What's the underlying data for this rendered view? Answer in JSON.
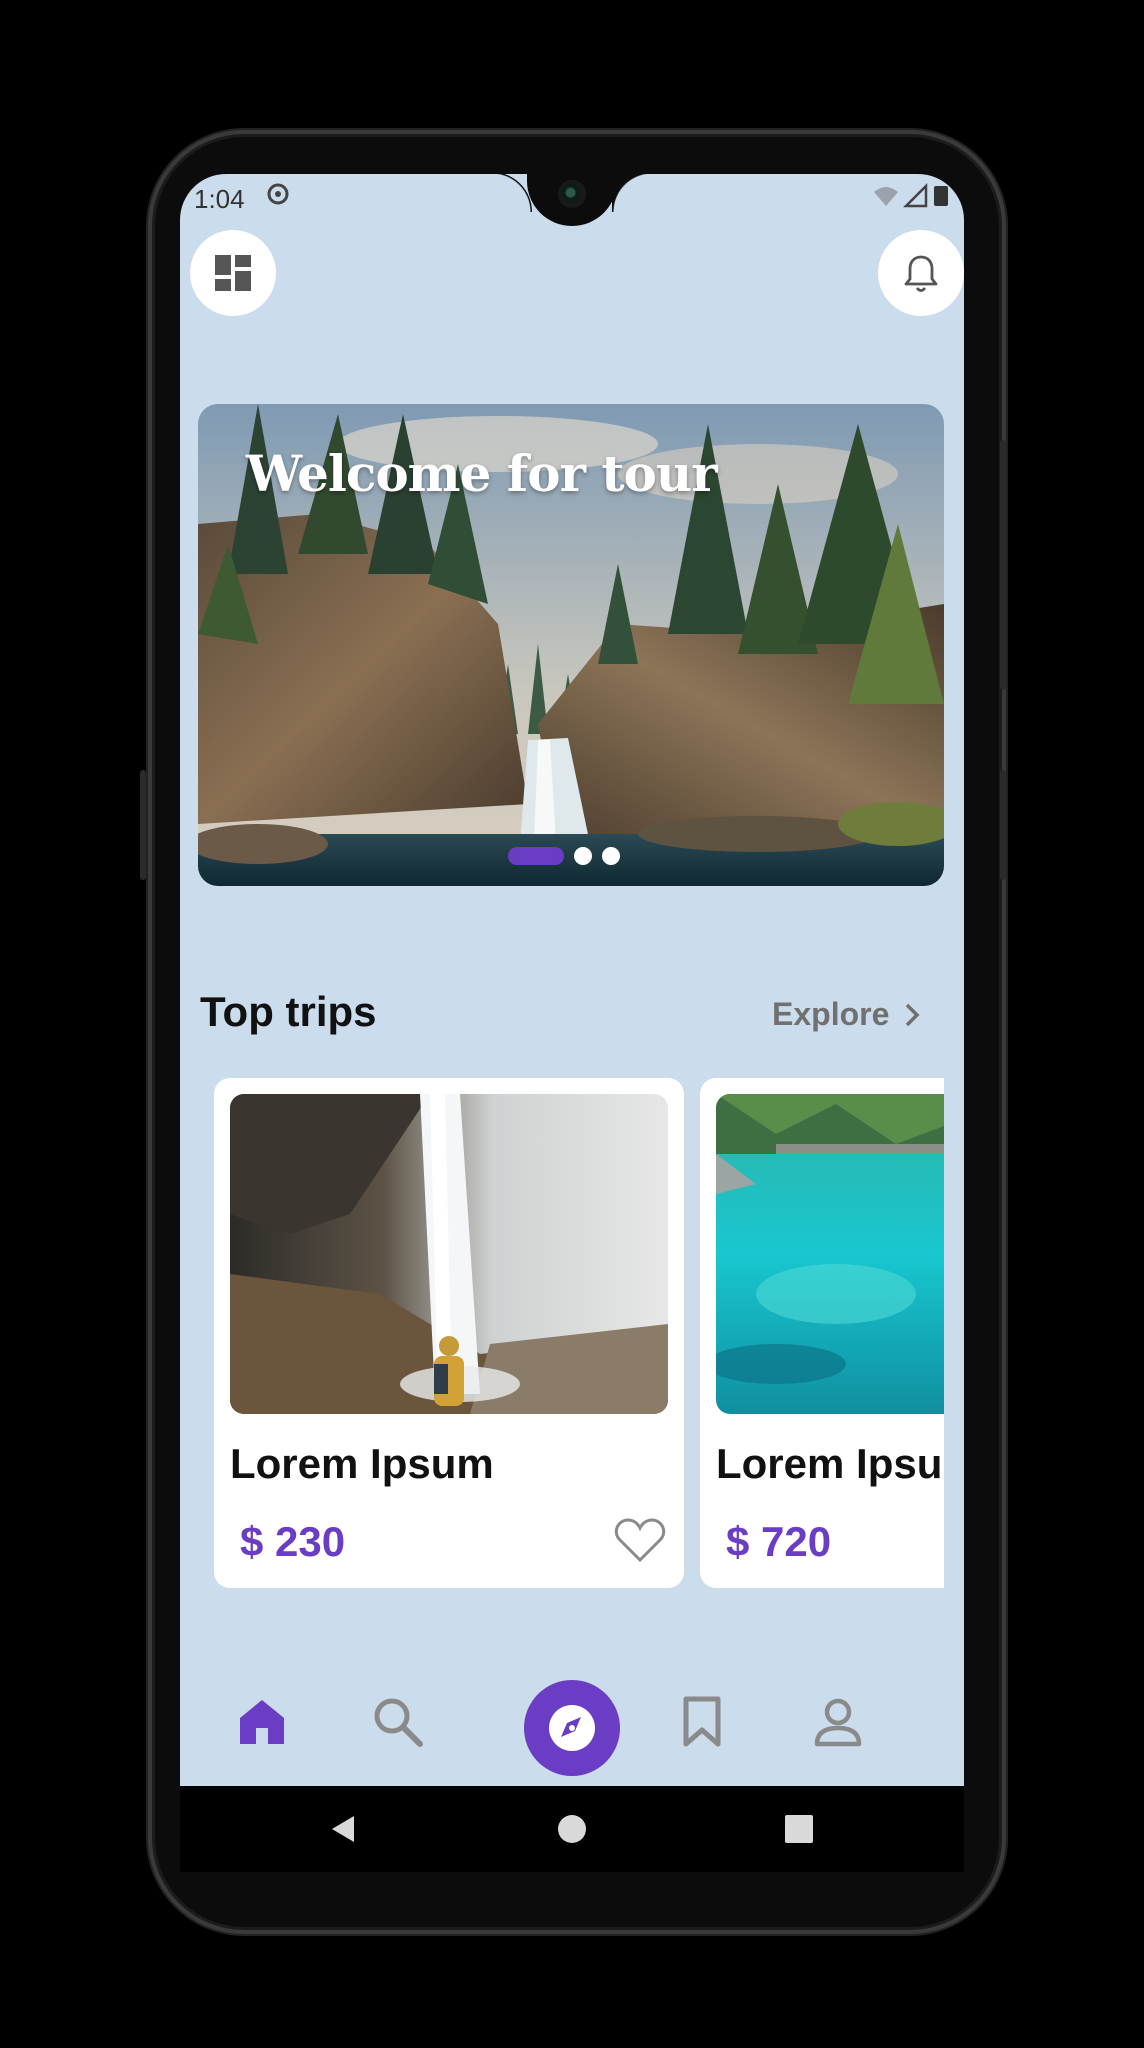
{
  "status_bar": {
    "time": "1:04"
  },
  "banner": {
    "title": "Welcome for tour",
    "slides": 3,
    "active_slide": 1
  },
  "section": {
    "title": "Top trips",
    "explore_label": "Explore"
  },
  "trips": [
    {
      "title": "Lorem Ipsum",
      "price": "$ 230"
    },
    {
      "title": "Lorem Ipsum",
      "price": "$ 720"
    }
  ],
  "colors": {
    "accent": "#6a3dc4",
    "background": "#cbdcec",
    "inactive_icon": "#8a8a8a"
  },
  "icons": {
    "top_left": "dashboard-icon",
    "top_right": "bell-icon",
    "nav": [
      "home-icon",
      "search-icon",
      "compass-icon",
      "bookmark-icon",
      "person-icon"
    ]
  }
}
